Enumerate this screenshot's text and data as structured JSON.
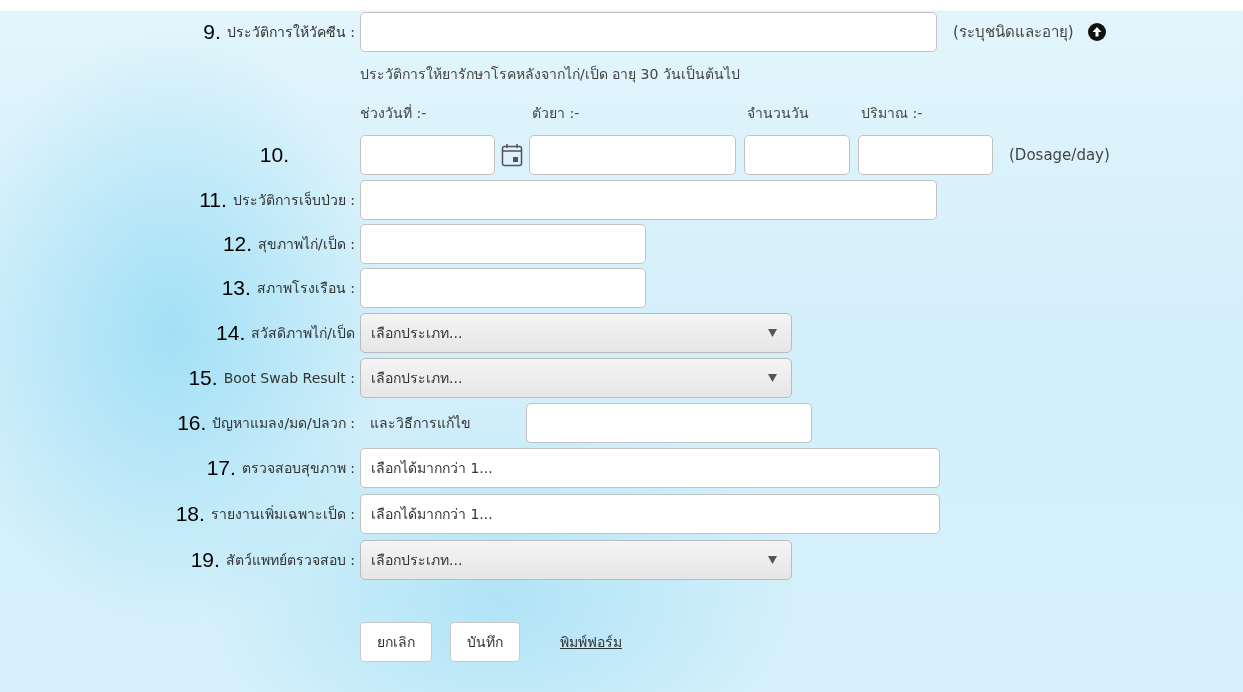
{
  "rows": [
    {
      "kind": "wide_text",
      "number": "9.",
      "label": "ประวัติการให้วัคซีน :",
      "suffix": "(ระบุชนิดและอายุ)",
      "upload_button": true
    },
    {
      "kind": "note",
      "text": "ประวัติการให้ยารักษาโรคหลังจากไก่/เป็ด อายุ 30 วันเป็นต้นไป"
    },
    {
      "kind": "headers",
      "headers": [
        "ช่วงวันที่ :-",
        "ตัวยา :-",
        "จำนวนวัน",
        "ปริมาณ :-"
      ]
    },
    {
      "kind": "dosage",
      "number": "10.",
      "suffix": "(Dosage/day)"
    },
    {
      "kind": "wide_text",
      "number": "11.",
      "label": "ประวัติการเจ็บป่วย :"
    },
    {
      "kind": "short_text",
      "number": "12.",
      "label": "สุขภาพไก่/เป็ด :"
    },
    {
      "kind": "short_text",
      "number": "13.",
      "label": "สภาพโรงเรือน :"
    },
    {
      "kind": "select",
      "number": "14.",
      "label": "สวัสดิภาพไก่/เป็ด",
      "value": "เลือกประเภท..."
    },
    {
      "kind": "select",
      "number": "15.",
      "label": "Boot Swab Result :",
      "value": "เลือกประเภท..."
    },
    {
      "kind": "prefixed",
      "number": "16.",
      "label": "ปัญหาแมลง/มด/ปลวก :",
      "prefix": "และวิธีการแก้ไข"
    },
    {
      "kind": "multi",
      "number": "17.",
      "label": "ตรวจสอบสุขภาพ :",
      "placeholder": "เลือกได้มากกว่า 1..."
    },
    {
      "kind": "multi",
      "number": "18.",
      "label": "รายงานเพิ่มเฉพาะเป็ด :",
      "placeholder": "เลือกได้มากกว่า 1..."
    },
    {
      "kind": "select",
      "number": "19.",
      "label": "สัตว์แพทย์ตรวจสอบ :",
      "value": "เลือกประเภท..."
    }
  ],
  "buttons": [
    "ยกเลิก",
    "บันทึก"
  ],
  "print_link": "พิมพ์ฟอร์ม"
}
